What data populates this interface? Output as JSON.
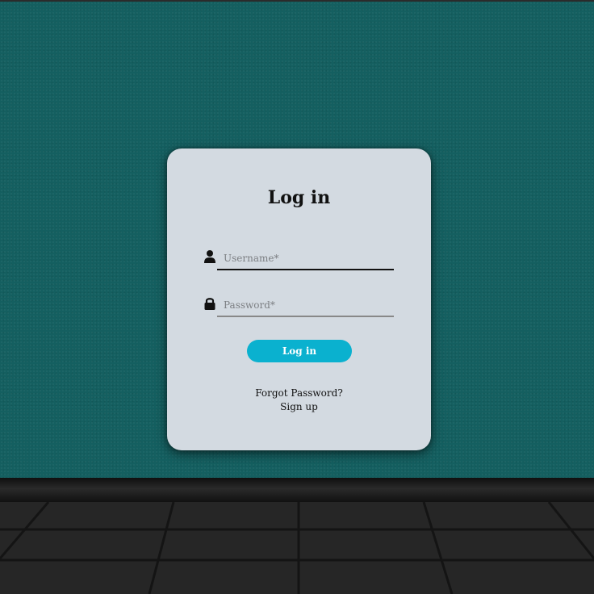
{
  "login": {
    "title": "Log in",
    "username": {
      "placeholder": "Username*",
      "value": "",
      "icon": "user-icon"
    },
    "password": {
      "placeholder": "Password*",
      "value": "",
      "icon": "lock-icon"
    },
    "submit_label": "Log in",
    "forgot_label": "Forgot Password?",
    "signup_label": "Sign up"
  },
  "colors": {
    "wall": "#145f60",
    "card": "#d3dae1",
    "button": "#0ab1cf",
    "button_text": "#ffffff"
  }
}
